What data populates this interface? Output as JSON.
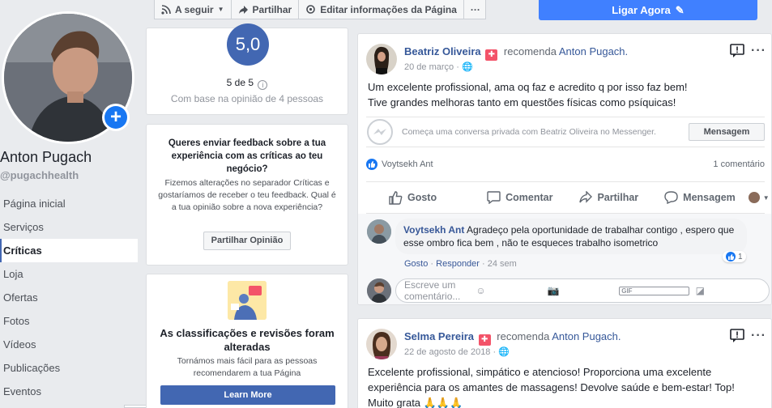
{
  "profile": {
    "name": "Anton Pugach",
    "handle": "@pugachhealth"
  },
  "nav": {
    "items": [
      {
        "label": "Página inicial"
      },
      {
        "label": "Serviços"
      },
      {
        "label": "Críticas"
      },
      {
        "label": "Loja"
      },
      {
        "label": "Ofertas"
      },
      {
        "label": "Fotos"
      },
      {
        "label": "Vídeos"
      },
      {
        "label": "Publicações"
      },
      {
        "label": "Eventos"
      }
    ],
    "active_index": 2
  },
  "toolbar": {
    "following_label": "A seguir",
    "share_label": "Partilhar",
    "edit_label": "Editar informações da Página",
    "more_label": "···",
    "call_label": "Ligar Agora"
  },
  "rating": {
    "score": "5,0",
    "out_of": "5 de 5",
    "based_on": "Com base na opinião de 4 pessoas"
  },
  "feedback": {
    "title": "Queres enviar feedback sobre a tua experiência com as críticas ao teu negócio?",
    "body": "Fizemos alterações no separador Críticas e gostaríamos de receber o teu feedback. Qual é a tua opinião sobre a nova experiência?",
    "button": "Partilhar Opinião"
  },
  "changes": {
    "title": "As classificações e revisões foram alteradas",
    "body": "Tornámos mais fácil para as pessoas recomendarem a tua Página",
    "button": "Learn More"
  },
  "review1": {
    "author": "Beatriz Oliveira",
    "recommends": "recomenda",
    "page": "Anton Pugach.",
    "date": "20 de março",
    "line1": "Um excelente profissional, ama oq faz e acredito q por isso faz bem!",
    "line2": "Tive grandes melhoras tanto em questões físicas como psíquicas!",
    "messenger_text": "Começa uma conversa privada com Beatriz Oliveira no Messenger.",
    "messenger_button": "Mensagem",
    "likers": "Voytsekh Ant",
    "comment_count": "1 comentário",
    "actions": {
      "like": "Gosto",
      "comment": "Comentar",
      "share": "Partilhar",
      "message": "Mensagem"
    },
    "comment": {
      "author": "Voytsekh Ant",
      "text": "Agradeço pela oportunidade de trabalhar contigo , espero que esse ombro fica bem , não te esqueces trabalho isometrico",
      "like": "Gosto",
      "reply": "Responder",
      "time": "24 sem",
      "reactions": "1"
    },
    "write_placeholder": "Escreve um comentário..."
  },
  "review2": {
    "author": "Selma Pereira",
    "recommends": "recomenda",
    "page": "Anton Pugach.",
    "date": "22 de agosto de 2018",
    "line1": "Excelente profissional, simpático e atencioso! Proporciona uma excelente",
    "line2": "experiência para os amantes de massagens! Devolve saúde e bem-estar! Top!",
    "line3": "Muito grata 🙏🙏🙏"
  },
  "colors": {
    "brand": "#4267b2",
    "call_button": "#4080ff",
    "recommend_icon": "#f35369",
    "link": "#365899"
  }
}
